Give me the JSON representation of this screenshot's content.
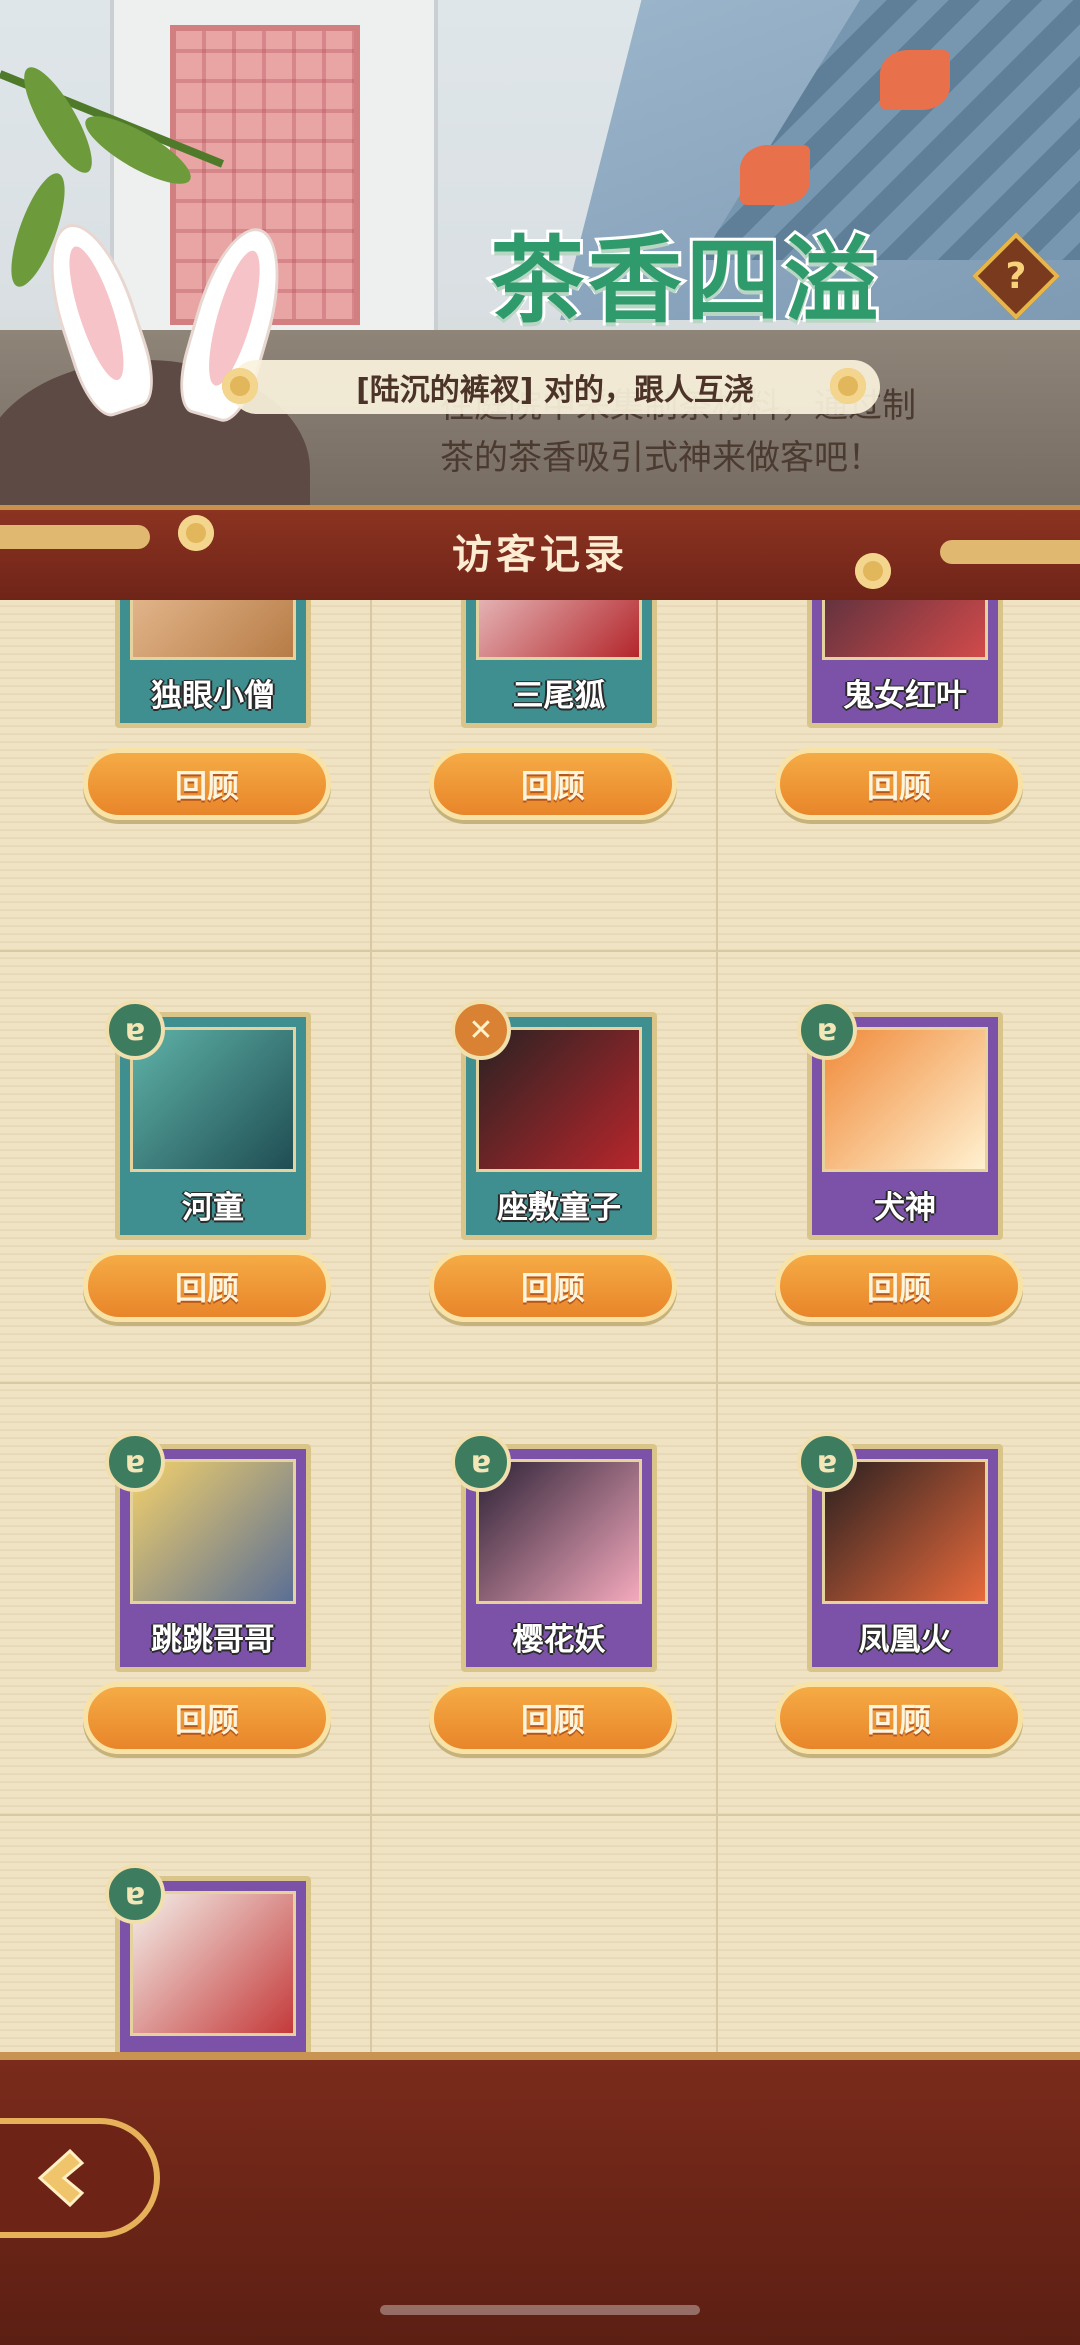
{
  "event": {
    "title": "茶香四溢",
    "description_line1": "往庭院中采集制茶材料，通过制",
    "description_line2": "茶的茶香吸引式神来做客吧！",
    "chat_message": "[陆沉的裤衩] 对的，跟人互浇",
    "help_label": "?"
  },
  "panel": {
    "title": "访客记录"
  },
  "visitors": [
    {
      "name": "独眼小僧",
      "button": "回顾",
      "card_color": "teal",
      "badge": ""
    },
    {
      "name": "三尾狐",
      "button": "回顾",
      "card_color": "teal",
      "badge": ""
    },
    {
      "name": "鬼女红叶",
      "button": "回顾",
      "card_color": "purple",
      "badge": ""
    },
    {
      "name": "河童",
      "button": "回顾",
      "card_color": "teal",
      "badge": "axe-icon"
    },
    {
      "name": "座敷童子",
      "button": "回顾",
      "card_color": "teal",
      "badge": "crossed-swords-icon"
    },
    {
      "name": "犬神",
      "button": "回顾",
      "card_color": "purple",
      "badge": "axe-icon"
    },
    {
      "name": "跳跳哥哥",
      "button": "回顾",
      "card_color": "purple",
      "badge": "axe-icon"
    },
    {
      "name": "樱花妖",
      "button": "回顾",
      "card_color": "purple",
      "badge": "axe-icon"
    },
    {
      "name": "凤凰火",
      "button": "回顾",
      "card_color": "purple",
      "badge": "axe-icon"
    },
    {
      "name": "",
      "button": "",
      "card_color": "purple",
      "badge": "axe-icon"
    }
  ],
  "colors": {
    "accent_green": "#2f9a6c",
    "button_orange": "#f5ab45",
    "header_brown": "#8c3321"
  },
  "nav": {
    "back_icon": "back-arrow-icon"
  }
}
